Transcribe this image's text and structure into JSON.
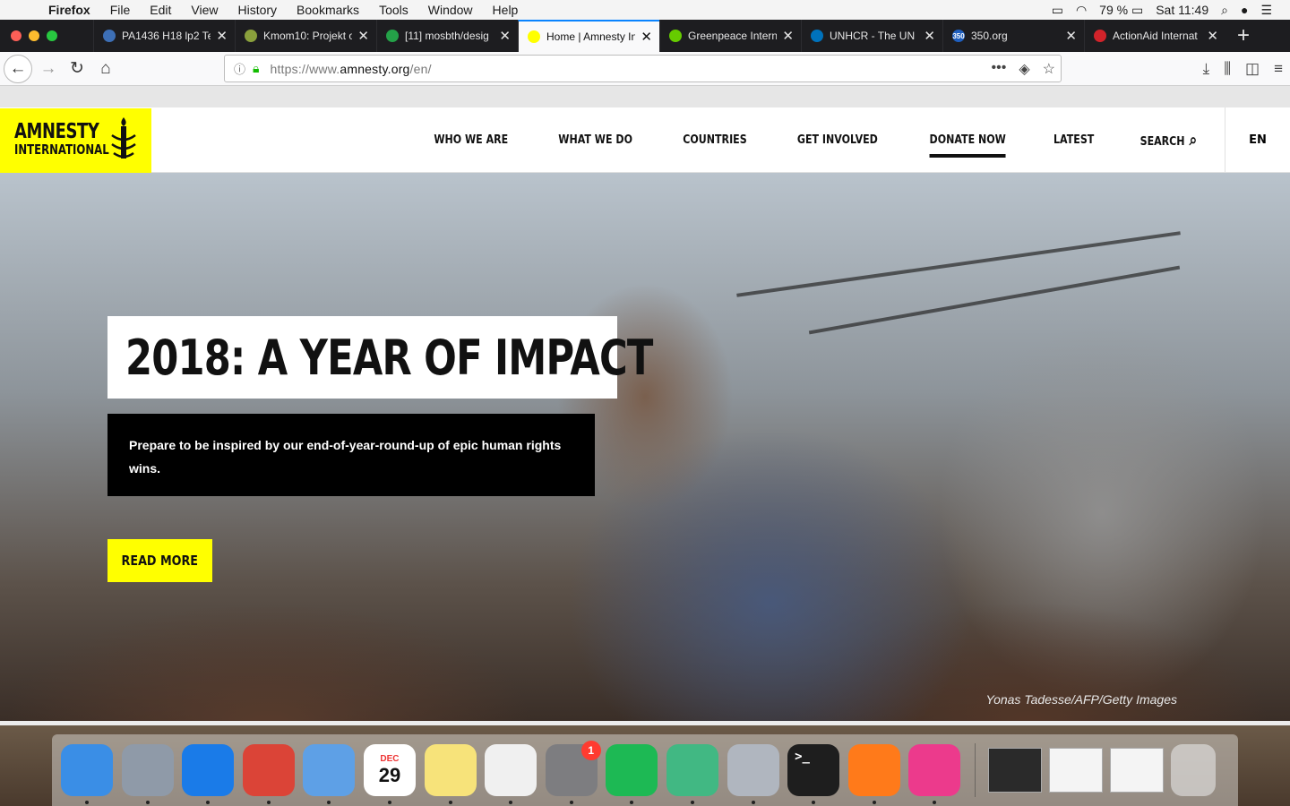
{
  "menubar": {
    "app": "Firefox",
    "items": [
      "File",
      "Edit",
      "View",
      "History",
      "Bookmarks",
      "Tools",
      "Window",
      "Help"
    ],
    "battery": "79 %",
    "clock": "Sat 11:49"
  },
  "tabs": [
    {
      "title": "PA1436 H18 lp2 Te",
      "favicon_color": "#3d6fb6"
    },
    {
      "title": "Kmom10: Projekt o",
      "favicon_color": "#8aa03c"
    },
    {
      "title": "[11] mosbth/desig",
      "favicon_color": "#24a148"
    },
    {
      "title": "Home | Amnesty In",
      "favicon_color": "#ffff00",
      "active": true
    },
    {
      "title": "Greenpeace Intern",
      "favicon_color": "#66cc00"
    },
    {
      "title": "UNHCR - The UN R",
      "favicon_color": "#0072bc"
    },
    {
      "title": "350.org",
      "favicon_color": "#1f5fbf",
      "favicon_text": "350"
    },
    {
      "title": "ActionAid Internat",
      "favicon_color": "#d2232a"
    }
  ],
  "url": {
    "prefix": "https://www.",
    "domain": "amnesty.org",
    "path": "/en/"
  },
  "site": {
    "logo_line1": "AMNESTY",
    "logo_line2": "INTERNATIONAL",
    "brand_color": "#ffff00",
    "nav": [
      "WHO WE ARE",
      "WHAT WE DO",
      "COUNTRIES",
      "GET INVOLVED",
      "DONATE NOW",
      "LATEST",
      "SEARCH"
    ],
    "lang": "EN"
  },
  "hero": {
    "headline": "2018: A YEAR OF IMPACT",
    "description": "Prepare to be inspired by our end-of-year-round-up of epic human rights wins.",
    "cta": "READ MORE",
    "credit": "Yonas Tadesse/AFP/Getty Images"
  },
  "dock": {
    "apps": [
      {
        "name": "finder-icon",
        "color": "#3a8ee6"
      },
      {
        "name": "launchpad-icon",
        "color": "#8f9aa8"
      },
      {
        "name": "safari-icon",
        "color": "#1a7be8"
      },
      {
        "name": "chrome-icon",
        "color": "#db4437"
      },
      {
        "name": "mail-icon",
        "color": "#5ea0e6"
      },
      {
        "name": "calendar-icon",
        "color": "#ffffff",
        "month": "DEC",
        "day": "29"
      },
      {
        "name": "notes-icon",
        "color": "#f7e37a"
      },
      {
        "name": "photos-icon",
        "color": "#f0f0f0"
      },
      {
        "name": "system-preferences-icon",
        "color": "#7d7d80",
        "badge": "1"
      },
      {
        "name": "spotify-icon",
        "color": "#1db954"
      },
      {
        "name": "atom-icon",
        "color": "#41b883"
      },
      {
        "name": "settings-icon",
        "color": "#b0b6bf"
      },
      {
        "name": "terminal-icon",
        "color": "#1e1e1e",
        "label": ">_"
      },
      {
        "name": "firefox-icon",
        "color": "#ff7a1a"
      },
      {
        "name": "itunes-icon",
        "color": "#ec3a8c"
      }
    ]
  }
}
